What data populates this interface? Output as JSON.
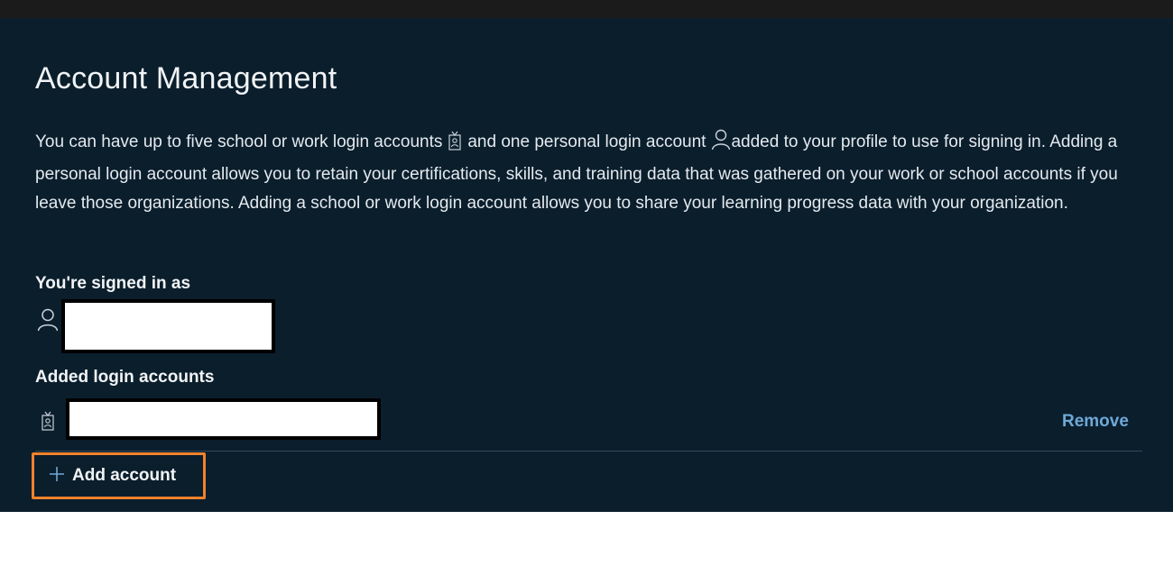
{
  "page": {
    "title": "Account Management",
    "description": {
      "part1": "You can have up to five school or work login accounts",
      "part2": "and one personal login account",
      "part3": "added to your profile to use for signing in. Adding a personal login account allows you to retain your certifications, skills, and training data that was gathered on your work or school accounts if you leave those organizations. Adding a school or work login account allows you to share your learning progress data with your organization."
    },
    "signed_in_label": "You're signed in as",
    "added_accounts_label": "Added login accounts",
    "remove_label": "Remove",
    "add_account_label": "Add account"
  },
  "icons": {
    "work_account": "id-badge-icon",
    "personal_account": "person-icon",
    "add": "plus-icon"
  },
  "colors": {
    "panel_bg": "#0b1e2c",
    "link": "#6ea9d7",
    "highlight_outline": "#f0832b"
  }
}
